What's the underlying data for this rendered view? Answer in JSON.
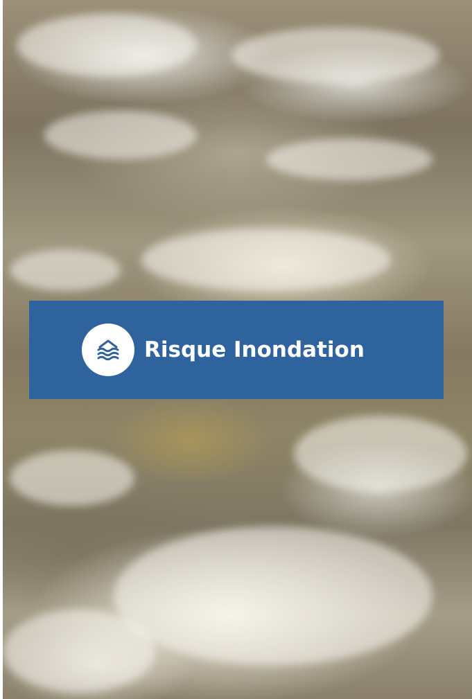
{
  "banner": {
    "title": "Risque Inondation",
    "icon": "flood-waves-icon",
    "background_color": "#2e639e",
    "text_color": "#ffffff"
  },
  "background": {
    "image": "turbulent-flood-water-photo"
  }
}
